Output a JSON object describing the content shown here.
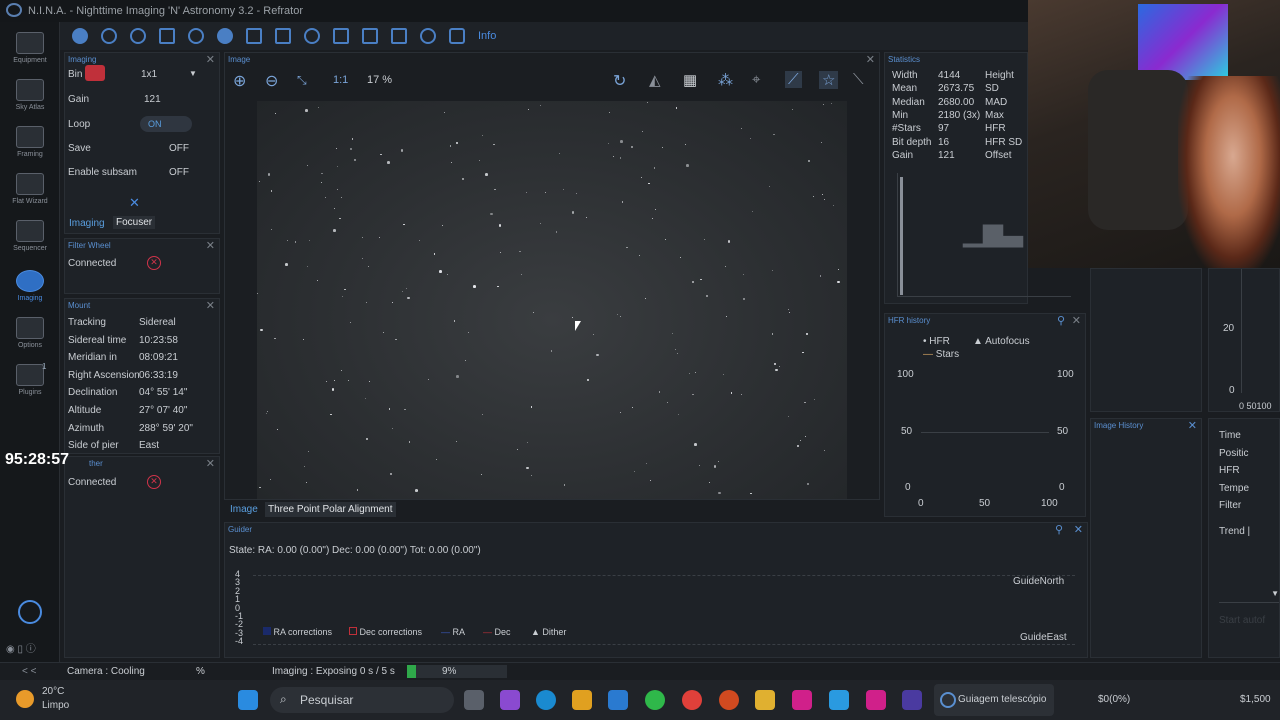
{
  "titlebar": {
    "title": "N.I.N.A. - Nighttime Imaging 'N' Astronomy 3.2  -  Refrator"
  },
  "nav": [
    {
      "label": "Equipment",
      "icon": "camera-icon"
    },
    {
      "label": "Sky Atlas",
      "icon": "atlas-icon"
    },
    {
      "label": "Framing",
      "icon": "framing-icon"
    },
    {
      "label": "Flat Wizard",
      "icon": "flat-wizard-icon"
    },
    {
      "label": "Sequencer",
      "icon": "sequencer-icon"
    },
    {
      "label": "Imaging",
      "icon": "imaging-icon"
    },
    {
      "label": "Options",
      "icon": "gear-icon"
    },
    {
      "label": "Plugins",
      "icon": "puzzle-icon"
    }
  ],
  "plugins_badge": "1",
  "toolbar": {
    "info_label": "Info"
  },
  "imaging_panel": {
    "title": "Imaging",
    "bin_label": "Bin",
    "bin_value": "1x1",
    "gain_label": "Gain",
    "gain_value": "121",
    "loop_label": "Loop",
    "loop_value": "ON",
    "save_label": "Save",
    "save_value": "OFF",
    "subsam_label": "Enable subsam",
    "subsam_value": "OFF",
    "tab_imaging": "Imaging",
    "tab_focuser": "Focuser"
  },
  "filter_wheel": {
    "title": "Filter Wheel",
    "connected_label": "Connected"
  },
  "mount": {
    "title": "Mount",
    "rows": [
      {
        "k": "Tracking",
        "v": "Sidereal"
      },
      {
        "k": "Sidereal time",
        "v": "10:23:58"
      },
      {
        "k": "Meridian in",
        "v": "08:09:21"
      },
      {
        "k": "Right Ascension",
        "v": "06:33:19"
      },
      {
        "k": "Declination",
        "v": "04° 55' 14\""
      },
      {
        "k": "Altitude",
        "v": "27° 07' 40\""
      },
      {
        "k": "Azimuth",
        "v": "288° 59' 20\""
      },
      {
        "k": "Side of pier",
        "v": "East"
      }
    ]
  },
  "weather": {
    "title": "ther",
    "connected_label": "Connected"
  },
  "overlay_clock": "95:28:57",
  "image_panel": {
    "title": "Image",
    "zoom": "17 %",
    "one_to_one": "1:1",
    "tab_image": "Image",
    "tab_tppa": "Three Point Polar Alignment"
  },
  "statistics": {
    "title": "Statistics",
    "rows": [
      {
        "k": "Width",
        "v": "4144",
        "k2": "Height"
      },
      {
        "k": "Mean",
        "v": "2673.75",
        "k2": "SD"
      },
      {
        "k": "Median",
        "v": "2680.00",
        "k2": "MAD"
      },
      {
        "k": "Min",
        "v": "2180 (3x)",
        "k2": "Max"
      },
      {
        "k": "#Stars",
        "v": "97",
        "k2": "HFR"
      },
      {
        "k": "Bit depth",
        "v": "16",
        "k2": "HFR SD"
      },
      {
        "k": "Gain",
        "v": "121",
        "k2": "Offset"
      }
    ]
  },
  "hfr_history": {
    "title": "HFR history",
    "legend_hfr": "HFR",
    "legend_af": "Autofocus",
    "legend_stars": "Stars",
    "y_left": [
      "100",
      "50",
      "0"
    ],
    "y_right": [
      "100",
      "50",
      "0"
    ],
    "x": [
      "0",
      "50",
      "100"
    ]
  },
  "right_chart": {
    "y": [
      "20",
      "0"
    ],
    "x": "0 50100"
  },
  "image_history": {
    "title": "Image History"
  },
  "right_list": {
    "items": [
      "Time",
      "Positic",
      "HFR",
      "Tempe",
      "Filter",
      "Trend |"
    ],
    "start_autofocus": "Start autof"
  },
  "guider": {
    "title": "Guider",
    "state": "State:  RA: 0.00 (0.00\")  Dec: 0.00 (0.00\")  Tot: 0.00 (0.00\")",
    "y": [
      "4",
      "3",
      "2",
      "1",
      "0",
      "-1",
      "-2",
      "-3",
      "-4"
    ],
    "guide_north": "GuideNorth",
    "guide_east": "GuideEast",
    "legend": [
      "RA corrections",
      "Dec corrections",
      "RA",
      "Dec",
      "Dither"
    ]
  },
  "statusbar": {
    "left_arrows": "< <",
    "camera": "Camera :  Cooling",
    "percent": "%",
    "imaging": "Imaging :  Exposing 0 s / 5 s",
    "progress": "9%"
  },
  "progress_fraction": 0.09,
  "taskbar": {
    "temp": "20°C",
    "weather": "Limpo",
    "search": "Pesquisar",
    "active_app": "Guiagem telescópio",
    "balance1": "$0(0%)",
    "balance2": "$1,500"
  }
}
